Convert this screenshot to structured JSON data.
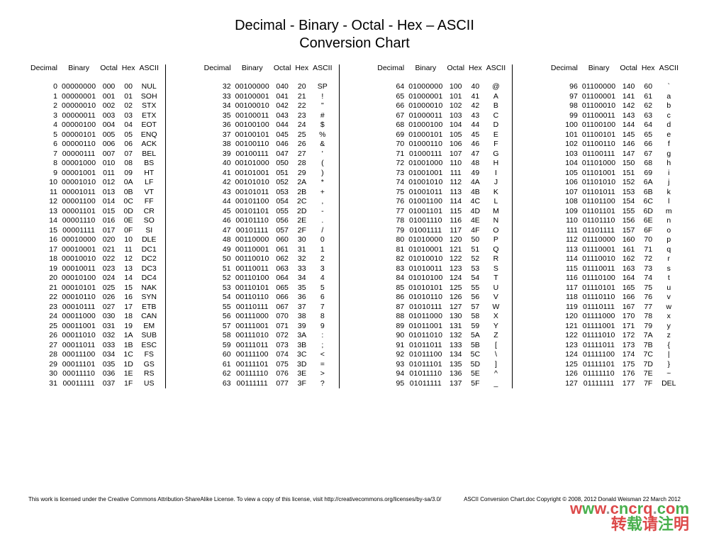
{
  "title": "Decimal - Binary - Octal - Hex – ASCII",
  "subtitle": "Conversion Chart",
  "headers": [
    "Decimal",
    "Binary",
    "Octal",
    "Hex",
    "ASCII"
  ],
  "footer_left": "This work is licensed under the Creative Commons Attribution-ShareAlike License. To view a copy of this license, visit http://creativecommons.org/licenses/by-sa/3.0/",
  "footer_right": "ASCII Conversion Chart.doc    Copyright © 2008, 2012    Donald Weisman    22 March 2012",
  "watermark_url_parts": [
    "w",
    "w",
    "w",
    ".",
    "c",
    "n",
    "c",
    "r",
    "q",
    ".",
    "c",
    "o",
    "m"
  ],
  "watermark_zh": "转载请注明",
  "chart_data": {
    "type": "table",
    "columns": [
      "Decimal",
      "Binary",
      "Octal",
      "Hex",
      "ASCII"
    ],
    "blocks": [
      [
        {
          "dec": 0,
          "bin": "00000000",
          "oct": "000",
          "hex": "00",
          "asc": "NUL"
        },
        {
          "dec": 1,
          "bin": "00000001",
          "oct": "001",
          "hex": "01",
          "asc": "SOH"
        },
        {
          "dec": 2,
          "bin": "00000010",
          "oct": "002",
          "hex": "02",
          "asc": "STX"
        },
        {
          "dec": 3,
          "bin": "00000011",
          "oct": "003",
          "hex": "03",
          "asc": "ETX"
        },
        {
          "dec": 4,
          "bin": "00000100",
          "oct": "004",
          "hex": "04",
          "asc": "EOT"
        },
        {
          "dec": 5,
          "bin": "00000101",
          "oct": "005",
          "hex": "05",
          "asc": "ENQ"
        },
        {
          "dec": 6,
          "bin": "00000110",
          "oct": "006",
          "hex": "06",
          "asc": "ACK"
        },
        {
          "dec": 7,
          "bin": "00000111",
          "oct": "007",
          "hex": "07",
          "asc": "BEL"
        },
        {
          "dec": 8,
          "bin": "00001000",
          "oct": "010",
          "hex": "08",
          "asc": "BS"
        },
        {
          "dec": 9,
          "bin": "00001001",
          "oct": "011",
          "hex": "09",
          "asc": "HT"
        },
        {
          "dec": 10,
          "bin": "00001010",
          "oct": "012",
          "hex": "0A",
          "asc": "LF"
        },
        {
          "dec": 11,
          "bin": "00001011",
          "oct": "013",
          "hex": "0B",
          "asc": "VT"
        },
        {
          "dec": 12,
          "bin": "00001100",
          "oct": "014",
          "hex": "0C",
          "asc": "FF"
        },
        {
          "dec": 13,
          "bin": "00001101",
          "oct": "015",
          "hex": "0D",
          "asc": "CR"
        },
        {
          "dec": 14,
          "bin": "00001110",
          "oct": "016",
          "hex": "0E",
          "asc": "SO"
        },
        {
          "dec": 15,
          "bin": "00001111",
          "oct": "017",
          "hex": "0F",
          "asc": "SI"
        },
        {
          "dec": 16,
          "bin": "00010000",
          "oct": "020",
          "hex": "10",
          "asc": "DLE"
        },
        {
          "dec": 17,
          "bin": "00010001",
          "oct": "021",
          "hex": "11",
          "asc": "DC1"
        },
        {
          "dec": 18,
          "bin": "00010010",
          "oct": "022",
          "hex": "12",
          "asc": "DC2"
        },
        {
          "dec": 19,
          "bin": "00010011",
          "oct": "023",
          "hex": "13",
          "asc": "DC3"
        },
        {
          "dec": 20,
          "bin": "00010100",
          "oct": "024",
          "hex": "14",
          "asc": "DC4"
        },
        {
          "dec": 21,
          "bin": "00010101",
          "oct": "025",
          "hex": "15",
          "asc": "NAK"
        },
        {
          "dec": 22,
          "bin": "00010110",
          "oct": "026",
          "hex": "16",
          "asc": "SYN"
        },
        {
          "dec": 23,
          "bin": "00010111",
          "oct": "027",
          "hex": "17",
          "asc": "ETB"
        },
        {
          "dec": 24,
          "bin": "00011000",
          "oct": "030",
          "hex": "18",
          "asc": "CAN"
        },
        {
          "dec": 25,
          "bin": "00011001",
          "oct": "031",
          "hex": "19",
          "asc": "EM"
        },
        {
          "dec": 26,
          "bin": "00011010",
          "oct": "032",
          "hex": "1A",
          "asc": "SUB"
        },
        {
          "dec": 27,
          "bin": "00011011",
          "oct": "033",
          "hex": "1B",
          "asc": "ESC"
        },
        {
          "dec": 28,
          "bin": "00011100",
          "oct": "034",
          "hex": "1C",
          "asc": "FS"
        },
        {
          "dec": 29,
          "bin": "00011101",
          "oct": "035",
          "hex": "1D",
          "asc": "GS"
        },
        {
          "dec": 30,
          "bin": "00011110",
          "oct": "036",
          "hex": "1E",
          "asc": "RS"
        },
        {
          "dec": 31,
          "bin": "00011111",
          "oct": "037",
          "hex": "1F",
          "asc": "US"
        }
      ],
      [
        {
          "dec": 32,
          "bin": "00100000",
          "oct": "040",
          "hex": "20",
          "asc": "SP"
        },
        {
          "dec": 33,
          "bin": "00100001",
          "oct": "041",
          "hex": "21",
          "asc": "!"
        },
        {
          "dec": 34,
          "bin": "00100010",
          "oct": "042",
          "hex": "22",
          "asc": "\""
        },
        {
          "dec": 35,
          "bin": "00100011",
          "oct": "043",
          "hex": "23",
          "asc": "#"
        },
        {
          "dec": 36,
          "bin": "00100100",
          "oct": "044",
          "hex": "24",
          "asc": "$"
        },
        {
          "dec": 37,
          "bin": "00100101",
          "oct": "045",
          "hex": "25",
          "asc": "%"
        },
        {
          "dec": 38,
          "bin": "00100110",
          "oct": "046",
          "hex": "26",
          "asc": "&"
        },
        {
          "dec": 39,
          "bin": "00100111",
          "oct": "047",
          "hex": "27",
          "asc": "'"
        },
        {
          "dec": 40,
          "bin": "00101000",
          "oct": "050",
          "hex": "28",
          "asc": "("
        },
        {
          "dec": 41,
          "bin": "00101001",
          "oct": "051",
          "hex": "29",
          "asc": ")"
        },
        {
          "dec": 42,
          "bin": "00101010",
          "oct": "052",
          "hex": "2A",
          "asc": "*"
        },
        {
          "dec": 43,
          "bin": "00101011",
          "oct": "053",
          "hex": "2B",
          "asc": "+"
        },
        {
          "dec": 44,
          "bin": "00101100",
          "oct": "054",
          "hex": "2C",
          "asc": ","
        },
        {
          "dec": 45,
          "bin": "00101101",
          "oct": "055",
          "hex": "2D",
          "asc": "-"
        },
        {
          "dec": 46,
          "bin": "00101110",
          "oct": "056",
          "hex": "2E",
          "asc": "."
        },
        {
          "dec": 47,
          "bin": "00101111",
          "oct": "057",
          "hex": "2F",
          "asc": "/"
        },
        {
          "dec": 48,
          "bin": "00110000",
          "oct": "060",
          "hex": "30",
          "asc": "0"
        },
        {
          "dec": 49,
          "bin": "00110001",
          "oct": "061",
          "hex": "31",
          "asc": "1"
        },
        {
          "dec": 50,
          "bin": "00110010",
          "oct": "062",
          "hex": "32",
          "asc": "2"
        },
        {
          "dec": 51,
          "bin": "00110011",
          "oct": "063",
          "hex": "33",
          "asc": "3"
        },
        {
          "dec": 52,
          "bin": "00110100",
          "oct": "064",
          "hex": "34",
          "asc": "4"
        },
        {
          "dec": 53,
          "bin": "00110101",
          "oct": "065",
          "hex": "35",
          "asc": "5"
        },
        {
          "dec": 54,
          "bin": "00110110",
          "oct": "066",
          "hex": "36",
          "asc": "6"
        },
        {
          "dec": 55,
          "bin": "00110111",
          "oct": "067",
          "hex": "37",
          "asc": "7"
        },
        {
          "dec": 56,
          "bin": "00111000",
          "oct": "070",
          "hex": "38",
          "asc": "8"
        },
        {
          "dec": 57,
          "bin": "00111001",
          "oct": "071",
          "hex": "39",
          "asc": "9"
        },
        {
          "dec": 58,
          "bin": "00111010",
          "oct": "072",
          "hex": "3A",
          "asc": ":"
        },
        {
          "dec": 59,
          "bin": "00111011",
          "oct": "073",
          "hex": "3B",
          "asc": ";"
        },
        {
          "dec": 60,
          "bin": "00111100",
          "oct": "074",
          "hex": "3C",
          "asc": "<"
        },
        {
          "dec": 61,
          "bin": "00111101",
          "oct": "075",
          "hex": "3D",
          "asc": "="
        },
        {
          "dec": 62,
          "bin": "00111110",
          "oct": "076",
          "hex": "3E",
          "asc": ">"
        },
        {
          "dec": 63,
          "bin": "00111111",
          "oct": "077",
          "hex": "3F",
          "asc": "?"
        }
      ],
      [
        {
          "dec": 64,
          "bin": "01000000",
          "oct": "100",
          "hex": "40",
          "asc": "@"
        },
        {
          "dec": 65,
          "bin": "01000001",
          "oct": "101",
          "hex": "41",
          "asc": "A"
        },
        {
          "dec": 66,
          "bin": "01000010",
          "oct": "102",
          "hex": "42",
          "asc": "B"
        },
        {
          "dec": 67,
          "bin": "01000011",
          "oct": "103",
          "hex": "43",
          "asc": "C"
        },
        {
          "dec": 68,
          "bin": "01000100",
          "oct": "104",
          "hex": "44",
          "asc": "D"
        },
        {
          "dec": 69,
          "bin": "01000101",
          "oct": "105",
          "hex": "45",
          "asc": "E"
        },
        {
          "dec": 70,
          "bin": "01000110",
          "oct": "106",
          "hex": "46",
          "asc": "F"
        },
        {
          "dec": 71,
          "bin": "01000111",
          "oct": "107",
          "hex": "47",
          "asc": "G"
        },
        {
          "dec": 72,
          "bin": "01001000",
          "oct": "110",
          "hex": "48",
          "asc": "H"
        },
        {
          "dec": 73,
          "bin": "01001001",
          "oct": "111",
          "hex": "49",
          "asc": "I"
        },
        {
          "dec": 74,
          "bin": "01001010",
          "oct": "112",
          "hex": "4A",
          "asc": "J"
        },
        {
          "dec": 75,
          "bin": "01001011",
          "oct": "113",
          "hex": "4B",
          "asc": "K"
        },
        {
          "dec": 76,
          "bin": "01001100",
          "oct": "114",
          "hex": "4C",
          "asc": "L"
        },
        {
          "dec": 77,
          "bin": "01001101",
          "oct": "115",
          "hex": "4D",
          "asc": "M"
        },
        {
          "dec": 78,
          "bin": "01001110",
          "oct": "116",
          "hex": "4E",
          "asc": "N"
        },
        {
          "dec": 79,
          "bin": "01001111",
          "oct": "117",
          "hex": "4F",
          "asc": "O"
        },
        {
          "dec": 80,
          "bin": "01010000",
          "oct": "120",
          "hex": "50",
          "asc": "P"
        },
        {
          "dec": 81,
          "bin": "01010001",
          "oct": "121",
          "hex": "51",
          "asc": "Q"
        },
        {
          "dec": 82,
          "bin": "01010010",
          "oct": "122",
          "hex": "52",
          "asc": "R"
        },
        {
          "dec": 83,
          "bin": "01010011",
          "oct": "123",
          "hex": "53",
          "asc": "S"
        },
        {
          "dec": 84,
          "bin": "01010100",
          "oct": "124",
          "hex": "54",
          "asc": "T"
        },
        {
          "dec": 85,
          "bin": "01010101",
          "oct": "125",
          "hex": "55",
          "asc": "U"
        },
        {
          "dec": 86,
          "bin": "01010110",
          "oct": "126",
          "hex": "56",
          "asc": "V"
        },
        {
          "dec": 87,
          "bin": "01010111",
          "oct": "127",
          "hex": "57",
          "asc": "W"
        },
        {
          "dec": 88,
          "bin": "01011000",
          "oct": "130",
          "hex": "58",
          "asc": "X"
        },
        {
          "dec": 89,
          "bin": "01011001",
          "oct": "131",
          "hex": "59",
          "asc": "Y"
        },
        {
          "dec": 90,
          "bin": "01011010",
          "oct": "132",
          "hex": "5A",
          "asc": "Z"
        },
        {
          "dec": 91,
          "bin": "01011011",
          "oct": "133",
          "hex": "5B",
          "asc": "["
        },
        {
          "dec": 92,
          "bin": "01011100",
          "oct": "134",
          "hex": "5C",
          "asc": "\\"
        },
        {
          "dec": 93,
          "bin": "01011101",
          "oct": "135",
          "hex": "5D",
          "asc": "]"
        },
        {
          "dec": 94,
          "bin": "01011110",
          "oct": "136",
          "hex": "5E",
          "asc": "^"
        },
        {
          "dec": 95,
          "bin": "01011111",
          "oct": "137",
          "hex": "5F",
          "asc": "_"
        }
      ],
      [
        {
          "dec": 96,
          "bin": "01100000",
          "oct": "140",
          "hex": "60",
          "asc": "`"
        },
        {
          "dec": 97,
          "bin": "01100001",
          "oct": "141",
          "hex": "61",
          "asc": "a"
        },
        {
          "dec": 98,
          "bin": "01100010",
          "oct": "142",
          "hex": "62",
          "asc": "b"
        },
        {
          "dec": 99,
          "bin": "01100011",
          "oct": "143",
          "hex": "63",
          "asc": "c"
        },
        {
          "dec": 100,
          "bin": "01100100",
          "oct": "144",
          "hex": "64",
          "asc": "d"
        },
        {
          "dec": 101,
          "bin": "01100101",
          "oct": "145",
          "hex": "65",
          "asc": "e"
        },
        {
          "dec": 102,
          "bin": "01100110",
          "oct": "146",
          "hex": "66",
          "asc": "f"
        },
        {
          "dec": 103,
          "bin": "01100111",
          "oct": "147",
          "hex": "67",
          "asc": "g"
        },
        {
          "dec": 104,
          "bin": "01101000",
          "oct": "150",
          "hex": "68",
          "asc": "h"
        },
        {
          "dec": 105,
          "bin": "01101001",
          "oct": "151",
          "hex": "69",
          "asc": "i"
        },
        {
          "dec": 106,
          "bin": "01101010",
          "oct": "152",
          "hex": "6A",
          "asc": "j"
        },
        {
          "dec": 107,
          "bin": "01101011",
          "oct": "153",
          "hex": "6B",
          "asc": "k"
        },
        {
          "dec": 108,
          "bin": "01101100",
          "oct": "154",
          "hex": "6C",
          "asc": "l"
        },
        {
          "dec": 109,
          "bin": "01101101",
          "oct": "155",
          "hex": "6D",
          "asc": "m"
        },
        {
          "dec": 110,
          "bin": "01101110",
          "oct": "156",
          "hex": "6E",
          "asc": "n"
        },
        {
          "dec": 111,
          "bin": "01101111",
          "oct": "157",
          "hex": "6F",
          "asc": "o"
        },
        {
          "dec": 112,
          "bin": "01110000",
          "oct": "160",
          "hex": "70",
          "asc": "p"
        },
        {
          "dec": 113,
          "bin": "01110001",
          "oct": "161",
          "hex": "71",
          "asc": "q"
        },
        {
          "dec": 114,
          "bin": "01110010",
          "oct": "162",
          "hex": "72",
          "asc": "r"
        },
        {
          "dec": 115,
          "bin": "01110011",
          "oct": "163",
          "hex": "73",
          "asc": "s"
        },
        {
          "dec": 116,
          "bin": "01110100",
          "oct": "164",
          "hex": "74",
          "asc": "t"
        },
        {
          "dec": 117,
          "bin": "01110101",
          "oct": "165",
          "hex": "75",
          "asc": "u"
        },
        {
          "dec": 118,
          "bin": "01110110",
          "oct": "166",
          "hex": "76",
          "asc": "v"
        },
        {
          "dec": 119,
          "bin": "01110111",
          "oct": "167",
          "hex": "77",
          "asc": "w"
        },
        {
          "dec": 120,
          "bin": "01111000",
          "oct": "170",
          "hex": "78",
          "asc": "x"
        },
        {
          "dec": 121,
          "bin": "01111001",
          "oct": "171",
          "hex": "79",
          "asc": "y"
        },
        {
          "dec": 122,
          "bin": "01111010",
          "oct": "172",
          "hex": "7A",
          "asc": "z"
        },
        {
          "dec": 123,
          "bin": "01111011",
          "oct": "173",
          "hex": "7B",
          "asc": "{"
        },
        {
          "dec": 124,
          "bin": "01111100",
          "oct": "174",
          "hex": "7C",
          "asc": "|"
        },
        {
          "dec": 125,
          "bin": "01111101",
          "oct": "175",
          "hex": "7D",
          "asc": "}"
        },
        {
          "dec": 126,
          "bin": "01111110",
          "oct": "176",
          "hex": "7E",
          "asc": "~"
        },
        {
          "dec": 127,
          "bin": "01111111",
          "oct": "177",
          "hex": "7F",
          "asc": "DEL"
        }
      ]
    ]
  }
}
